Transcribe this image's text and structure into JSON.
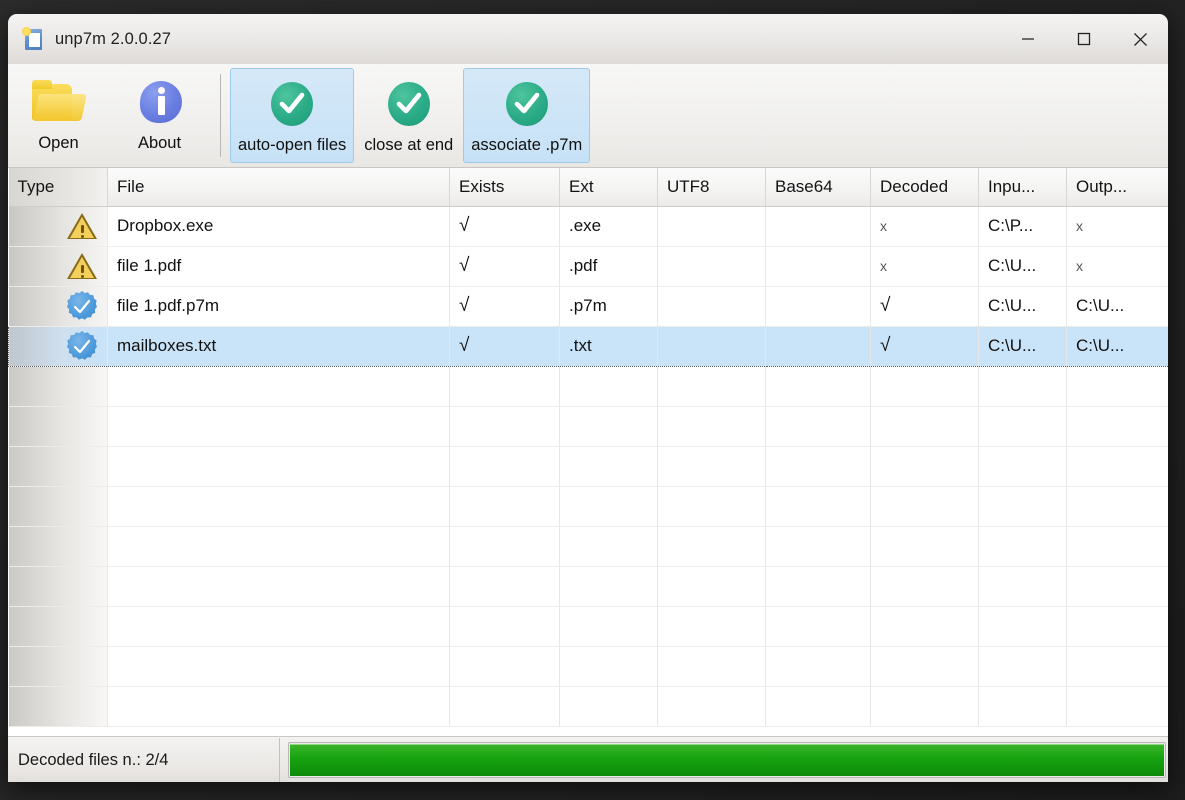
{
  "window": {
    "title": "unp7m 2.0.0.27",
    "app_icon": "document-star-icon",
    "controls": {
      "minimize": "minimize-icon",
      "maximize": "maximize-icon",
      "close": "close-icon"
    }
  },
  "toolbar": {
    "buttons": [
      {
        "label": "Open",
        "icon": "open-folder-icon",
        "state": "normal"
      },
      {
        "label": "About",
        "icon": "info-icon",
        "state": "normal"
      }
    ],
    "toggles": [
      {
        "label": "auto-open files",
        "icon": "green-check-icon",
        "checked": true,
        "highlighted": true
      },
      {
        "label": "close at end",
        "icon": "green-check-icon",
        "checked": true,
        "highlighted": false
      },
      {
        "label": "associate .p7m",
        "icon": "green-check-icon",
        "checked": true,
        "highlighted": true
      }
    ]
  },
  "grid": {
    "columns": [
      "Type",
      "File",
      "Exists",
      "Ext",
      "UTF8",
      "Base64",
      "Decoded",
      "Inpu...",
      "Outp..."
    ],
    "rows": [
      {
        "type_icon": "warning-icon",
        "file": "Dropbox.exe",
        "exists": "√",
        "ext": ".exe",
        "utf8": "",
        "base64": "",
        "decoded": "x",
        "input": "C:\\P...",
        "output": "x",
        "selected": false
      },
      {
        "type_icon": "warning-icon",
        "file": "file 1.pdf",
        "exists": "√",
        "ext": ".pdf",
        "utf8": "",
        "base64": "",
        "decoded": "x",
        "input": "C:\\U...",
        "output": "x",
        "selected": false
      },
      {
        "type_icon": "verified-badge-icon",
        "file": "file 1.pdf.p7m",
        "exists": "√",
        "ext": ".p7m",
        "utf8": "",
        "base64": "",
        "decoded": "√",
        "input": "C:\\U...",
        "output": "C:\\U...",
        "selected": false
      },
      {
        "type_icon": "verified-badge-icon",
        "file": "mailboxes.txt",
        "exists": "√",
        "ext": ".txt",
        "utf8": "",
        "base64": "",
        "decoded": "√",
        "input": "C:\\U...",
        "output": "C:\\U...",
        "selected": true
      }
    ],
    "empty_row_count": 9
  },
  "statusbar": {
    "text": "Decoded files n.: 2/4",
    "progress_percent": 100
  },
  "colors": {
    "accent_blue": "#c9e3f8",
    "check_green": "#2aab86",
    "progress_green": "#16a310",
    "warning_yellow": "#f3cf5e",
    "badge_blue": "#4a98da"
  }
}
